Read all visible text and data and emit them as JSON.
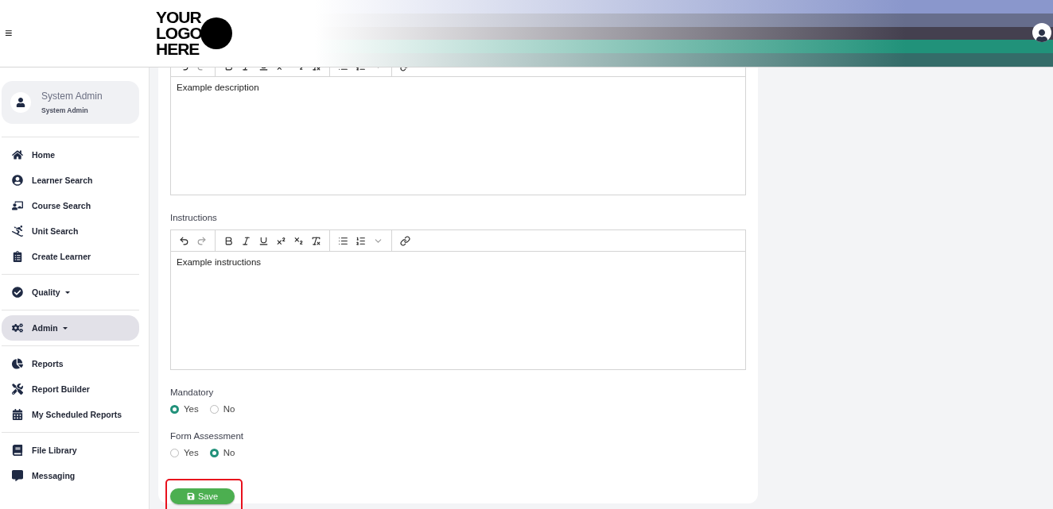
{
  "header": {
    "menu_glyph": "≡",
    "logo": [
      "YOUR",
      "LOGO",
      "HERE"
    ]
  },
  "user": {
    "name": "System Admin",
    "role": "System Admin"
  },
  "sidebar": {
    "groups": [
      [
        {
          "label": "Home",
          "selected": false
        },
        {
          "label": "Learner Search",
          "selected": false
        },
        {
          "label": "Course Search",
          "selected": false
        },
        {
          "label": "Unit Search",
          "selected": false
        },
        {
          "label": "Create Learner",
          "selected": false
        }
      ],
      [
        {
          "label": "Quality",
          "selected": false,
          "dropdown": true
        }
      ],
      [
        {
          "label": "Admin",
          "selected": true,
          "dropdown": true
        }
      ],
      [
        {
          "label": "Reports",
          "selected": false
        },
        {
          "label": "Report Builder",
          "selected": false
        },
        {
          "label": "My Scheduled Reports",
          "selected": false
        }
      ],
      [
        {
          "label": "File Library",
          "selected": false
        },
        {
          "label": "Messaging",
          "selected": false
        }
      ]
    ]
  },
  "form": {
    "description": {
      "value": "Example description"
    },
    "instructions": {
      "label": "Instructions",
      "value": "Example instructions"
    },
    "radio_groups": [
      {
        "label": "Mandatory",
        "options": [
          {
            "label": "Yes",
            "selected": true
          },
          {
            "label": "No",
            "selected": false
          }
        ]
      },
      {
        "label": "Form Assessment",
        "options": [
          {
            "label": "Yes",
            "selected": false
          },
          {
            "label": "No",
            "selected": true
          }
        ]
      }
    ],
    "save_button": {
      "label": "Save",
      "highlighted": true
    }
  }
}
